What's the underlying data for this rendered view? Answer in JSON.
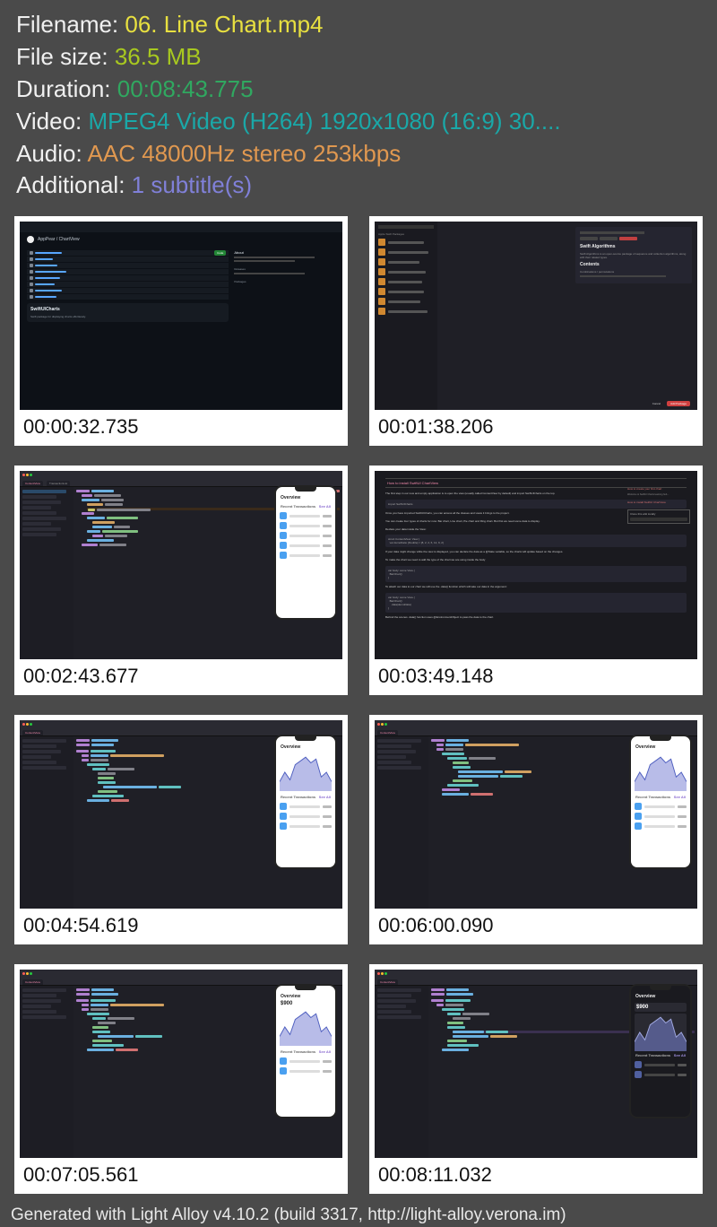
{
  "info": {
    "filename_label": "Filename: ",
    "filename_value": "06. Line Chart.mp4",
    "filesize_label": "File size: ",
    "filesize_value": "36.5 MB",
    "duration_label": "Duration: ",
    "duration_value": "00:08:43.775",
    "video_label": "Video: ",
    "video_value": "MPEG4 Video (H264) 1920x1080 (16:9) 30....",
    "audio_label": "Audio: ",
    "audio_value": "AAC 48000Hz stereo 253kbps",
    "additional_label": "Additional: ",
    "additional_value": "1 subtitle(s)"
  },
  "thumbnails": [
    {
      "timestamp": "00:00:32.735"
    },
    {
      "timestamp": "00:01:38.206"
    },
    {
      "timestamp": "00:02:43.677"
    },
    {
      "timestamp": "00:03:49.148"
    },
    {
      "timestamp": "00:04:54.619"
    },
    {
      "timestamp": "00:06:00.090"
    },
    {
      "timestamp": "00:07:05.561"
    },
    {
      "timestamp": "00:08:11.032"
    }
  ],
  "github": {
    "repo": "AppPear / ChartView",
    "readme_title": "SwiftUICharts",
    "readme_sub": "Swift package for displaying charts effortlessly.",
    "button": "Code"
  },
  "pkg": {
    "title": "Swift Algorithms",
    "section": "Contents",
    "sub": "Combinations / permutations",
    "cancel": "Cancel",
    "add": "Add Package",
    "header": "Apple Swift Packages"
  },
  "ide": {
    "project": "ExpenseTracker",
    "file": "ContentView"
  },
  "phone": {
    "title": "Overview",
    "big": "$900",
    "list_header": "Recent Transactions",
    "seeall": "See All"
  },
  "docs": {
    "tab": "How to install SwiftUI ChartView",
    "clone": "Clone this wiki locally"
  },
  "footer": "Generated with Light Alloy v4.10.2 (build 3317, http://light-alloy.verona.im)"
}
